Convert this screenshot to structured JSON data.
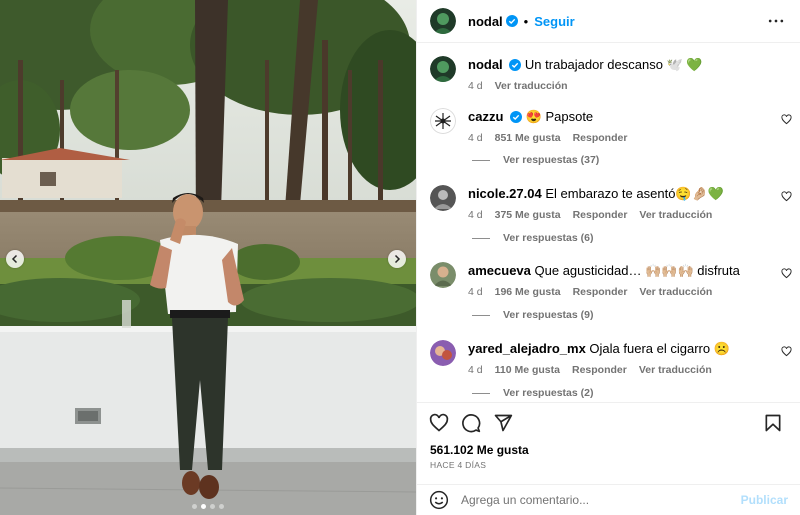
{
  "header": {
    "username": "nodal",
    "follow_label": "Seguir",
    "separator": "•"
  },
  "caption": {
    "username": "nodal",
    "text": "Un trabajador descanso 🕊️ 💚",
    "time": "4 d",
    "translate": "Ver traducción"
  },
  "comments": [
    {
      "username": "cazzu",
      "text": "😍 Papsote",
      "time": "4 d",
      "likes": "851 Me gusta",
      "reply": "Responder",
      "translate": "",
      "replies": "Ver respuestas (37)"
    },
    {
      "username": "nicole.27.04",
      "text": "El embarazo te asentó🤤🤌🏼💚",
      "time": "4 d",
      "likes": "375 Me gusta",
      "reply": "Responder",
      "translate": "Ver traducción",
      "replies": "Ver respuestas (6)"
    },
    {
      "username": "amecueva",
      "text": "Que agusticidad… 🙌🏼🙌🏼🙌🏼 disfruta",
      "time": "4 d",
      "likes": "196 Me gusta",
      "reply": "Responder",
      "translate": "Ver traducción",
      "replies": "Ver respuestas (9)"
    },
    {
      "username": "yared_alejadro_mx",
      "text": "Ojala fuera el cigarro ☹️",
      "time": "4 d",
      "likes": "110 Me gusta",
      "reply": "Responder",
      "translate": "Ver traducción",
      "replies": "Ver respuestas (2)"
    }
  ],
  "post": {
    "likes": "561.102 Me gusta",
    "date": "HACE 4 DÍAS"
  },
  "composer": {
    "placeholder": "Agrega un comentario...",
    "post_label": "Publicar"
  },
  "carousel": {
    "slides": 4,
    "active": 1
  },
  "colors": {
    "accent": "#0095f6",
    "verified": "#0095f6",
    "post_disabled": "#b2dffc",
    "muted": "#737373"
  },
  "icons": [
    "verified-badge-icon",
    "more-options-icon",
    "heart-icon",
    "comment-icon",
    "share-icon",
    "bookmark-icon",
    "emoji-icon",
    "chevron-left-icon",
    "chevron-right-icon"
  ]
}
